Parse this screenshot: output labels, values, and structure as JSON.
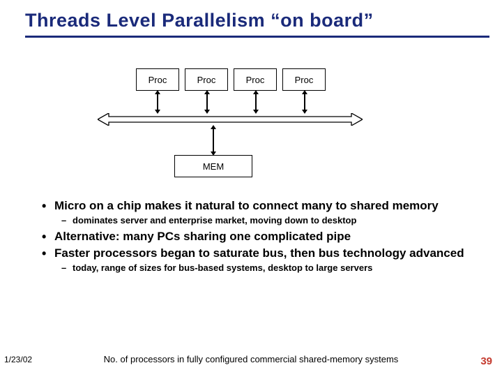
{
  "title": "Threads Level Parallelism “on board”",
  "diagram": {
    "proc_label": "Proc",
    "procs": [
      "Proc",
      "Proc",
      "Proc",
      "Proc"
    ],
    "mem_label": "MEM"
  },
  "bullets": [
    {
      "text": "Micro on a chip makes it natural to connect many to shared memory",
      "sub": [
        "dominates server and enterprise market, moving down to desktop"
      ]
    },
    {
      "text": "Alternative: many PCs sharing one complicated pipe",
      "sub": []
    },
    {
      "text": "Faster processors began to saturate bus, then bus technology advanced",
      "sub": [
        "today, range of sizes for bus-based systems, desktop to large servers"
      ]
    }
  ],
  "footer": {
    "date": "1/23/02",
    "caption": "No. of processors in fully configured commercial shared-memory systems",
    "page_number": "39"
  },
  "colors": {
    "title": "#1a2a7a",
    "page_num": "#c43a2e"
  }
}
